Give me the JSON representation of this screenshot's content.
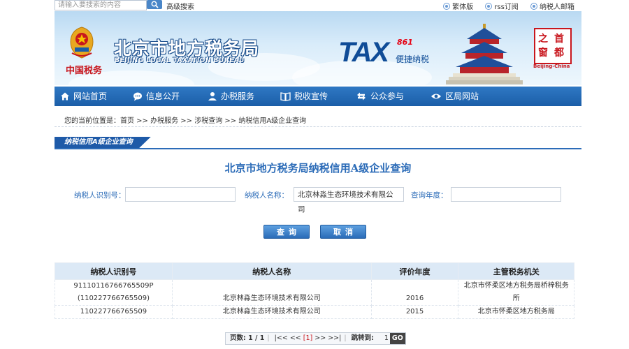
{
  "topbar": {
    "search_placeholder": "请输入要搜索的内容",
    "advanced_search": "高级搜索",
    "links": [
      "繁体版",
      "rss订阅",
      "纳税人邮箱"
    ]
  },
  "banner": {
    "emblem_text": "中国税务",
    "bureau_cn": "北京市地方税务局",
    "bureau_en": "BEIJING LOCAL TAXATION BUREAU",
    "tax_logo": "TAX",
    "tax_number": "861",
    "tax_sub": "便捷纳税",
    "seal_chars": [
      "之",
      "首",
      "窗",
      "都"
    ],
    "seal_caption": "Beijing-China"
  },
  "nav": {
    "items": [
      "网站首页",
      "信息公开",
      "办税服务",
      "税收宣传",
      "公众参与",
      "区局网站"
    ]
  },
  "breadcrumb": "您的当前位置是：首页 >> 办税服务 >> 涉税查询 >> 纳税信用A级企业查询",
  "section_tab": "纳税信用A级企业查询",
  "page_title": "北京市地方税务局纳税信用A级企业查询",
  "form": {
    "taxpayer_id_label": "纳税人识别号：",
    "taxpayer_id_value": "",
    "taxpayer_name_label": "纳税人名称：",
    "taxpayer_name_value": "北京林淼生态环境技术有限公司",
    "year_label": "查询年度：",
    "year_value": "",
    "query_button": "查询",
    "cancel_button": "取消"
  },
  "table": {
    "headers": [
      "纳税人识别号",
      "纳税人名称",
      "评价年度",
      "主管税务机关"
    ],
    "rows": [
      {
        "id_line1": "91110116766765509P",
        "id_line2": "(110227766765509)",
        "name": "北京林淼生态环境技术有限公司",
        "year": "2016",
        "office_line1": "北京市怀柔区地方税务局桥梓税务",
        "office_line2": "所"
      },
      {
        "id_line1": "110227766765509",
        "id_line2": "",
        "name": "北京林淼生态环境技术有限公司",
        "year": "2015",
        "office_line1": "北京市怀柔区地方税务局",
        "office_line2": ""
      }
    ]
  },
  "pager": {
    "page_info": "页数: 1 / 1",
    "first": "|<<",
    "prev": "<<",
    "current": "[1]",
    "next": ">>",
    "last": ">>|",
    "jump_label": "跳转到:",
    "jump_value": "1",
    "go": "GO"
  }
}
